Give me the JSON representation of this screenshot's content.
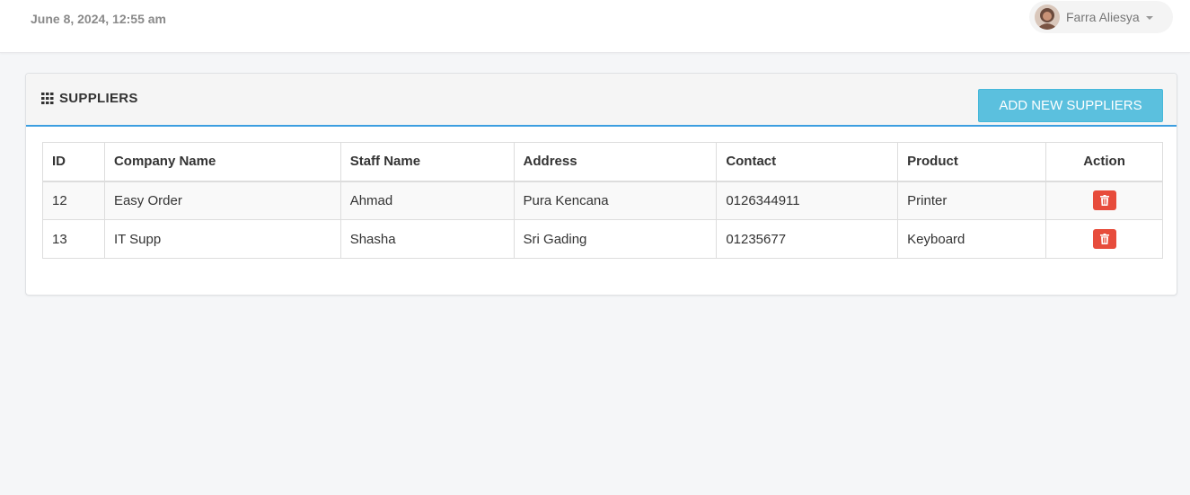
{
  "header": {
    "datetime": "June 8, 2024, 12:55 am",
    "user_name": "Farra Aliesya"
  },
  "panel": {
    "title": "SUPPLIERS",
    "add_button_label": "ADD NEW SUPPLIERS"
  },
  "table": {
    "columns": {
      "id": "ID",
      "company": "Company Name",
      "staff": "Staff Name",
      "address": "Address",
      "contact": "Contact",
      "product": "Product",
      "action": "Action"
    },
    "rows": [
      {
        "id": "12",
        "company": "Easy Order",
        "staff": "Ahmad",
        "address": "Pura Kencana",
        "contact": "0126344911",
        "product": "Printer"
      },
      {
        "id": "13",
        "company": "IT Supp",
        "staff": "Shasha",
        "address": "Sri Gading",
        "contact": "01235677",
        "product": "Keyboard"
      }
    ]
  },
  "icons": {
    "title_icon": "grid-icon",
    "delete_icon": "trash-icon",
    "user_caret": "caret-down-icon"
  },
  "colors": {
    "accent_line": "#3c9ee0",
    "add_button": "#5bc0de",
    "delete_button": "#e74c3c"
  }
}
